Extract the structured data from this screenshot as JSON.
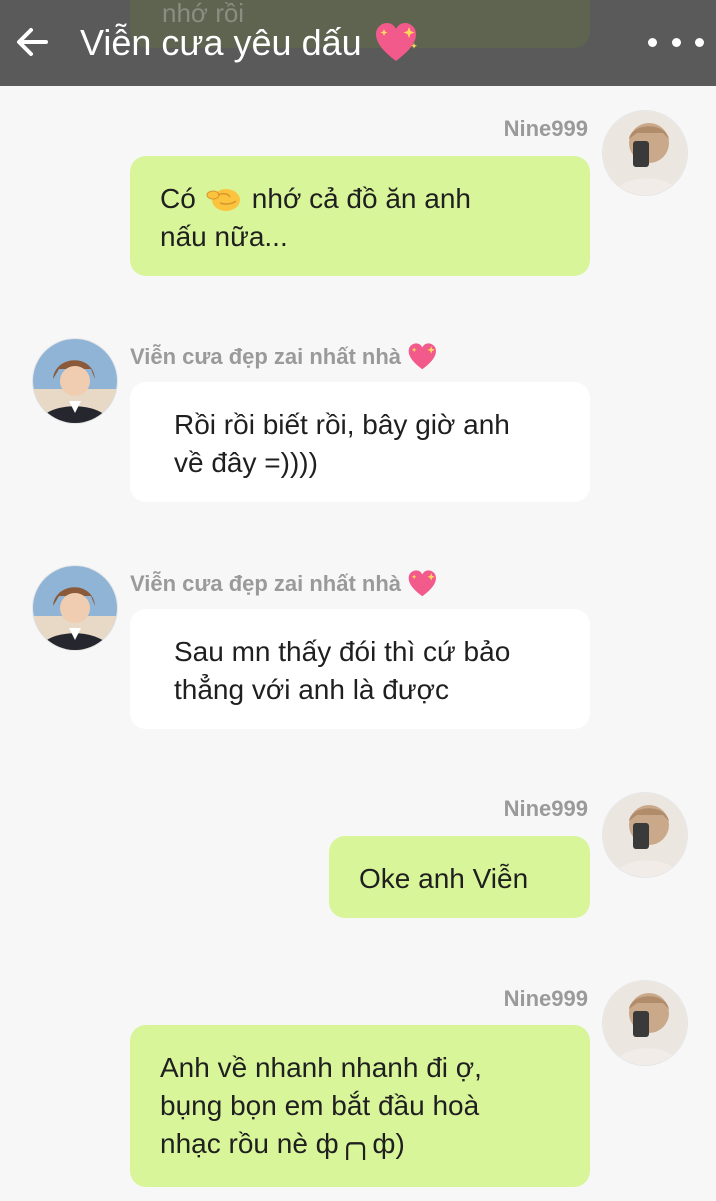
{
  "header": {
    "title": "Viễn cưa yêu dấu",
    "peek_text": "nhớ rồi"
  },
  "users": {
    "me": "Nine999",
    "other": "Viễn cưa đẹp zai nhất nhà"
  },
  "messages": [
    {
      "sender": "Nine999",
      "direction": "out",
      "line1_a": "Có",
      "line1_b": "nhớ cả đồ ăn anh",
      "line2": "nấu nữa..."
    },
    {
      "sender": "Viễn cưa đẹp zai nhất nhà",
      "direction": "in",
      "line1": "Rồi rồi biết rồi, bây giờ anh",
      "line2": "về đây =))))"
    },
    {
      "sender": "Viễn cưa đẹp zai nhất nhà",
      "direction": "in",
      "line1": "Sau mn thấy đói thì cứ bảo",
      "line2": "thẳng với anh là được"
    },
    {
      "sender": "Nine999",
      "direction": "out",
      "line1": "Oke anh Viễn"
    },
    {
      "sender": "Nine999",
      "direction": "out",
      "line1": "Anh về nhanh nhanh đi ợ,",
      "line2": "bụng bọn em bắt đầu hoà",
      "line3": "nhạc rồu nè ф╭╮ф)"
    }
  ],
  "colors": {
    "header_bg": "#5a5a5a",
    "chat_bg": "#f7f7f7",
    "outgoing_bubble": "#d8f59a",
    "incoming_bubble": "#ffffff",
    "name_text": "#9a9a9a",
    "heart": "#f25a8c"
  },
  "icons": [
    "back-arrow-icon",
    "sparkling-heart-icon",
    "more-options-icon",
    "pinching-hand-icon"
  ]
}
